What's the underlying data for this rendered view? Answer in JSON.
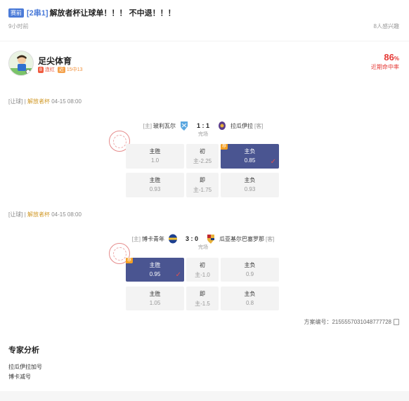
{
  "header": {
    "tag": "赛前",
    "bracket": "[2串1]",
    "title": "解放者杯让球单！！！ 不中退！！！",
    "time": "9小时前",
    "interest": "8人感兴趣"
  },
  "author": {
    "name": "足尖体育",
    "badge1_num": "8",
    "badge1_text": "连红",
    "badge2_num": "近",
    "badge2_text": "15中13",
    "hit_pct": "86",
    "hit_pct_unit": "%",
    "hit_label": "近期命中率"
  },
  "matches": [
    {
      "type": "[让球]",
      "sep": "|",
      "league": "解放者杯",
      "datetime": "04-15 08:00",
      "home_tag": "[主]",
      "home": "玻利瓦尔",
      "score": "1 : 1",
      "away": "拉瓜伊拉",
      "away_tag": "[客]",
      "status": "完场",
      "row1": {
        "home_label": "主胜",
        "home_val": "1.0",
        "mid_label": "初",
        "mid_val": "主-2.25",
        "away_label": "主负",
        "away_val": "0.85",
        "corner": "荐"
      },
      "row2": {
        "home_label": "主胜",
        "home_val": "0.93",
        "mid_label": "即",
        "mid_val": "主-1.75",
        "away_label": "主负",
        "away_val": "0.93"
      }
    },
    {
      "type": "[让球]",
      "sep": "|",
      "league": "解放者杯",
      "datetime": "04-15 08:00",
      "home_tag": "[主]",
      "home": "博卡青年",
      "score": "3 : 0",
      "away": "瓜亚基尔巴塞罗那",
      "away_tag": "[客]",
      "status": "完场",
      "row1": {
        "home_label": "主胜",
        "home_val": "0.95",
        "mid_label": "初",
        "mid_val": "主-1.0",
        "away_label": "主负",
        "away_val": "0.9",
        "corner": "荐"
      },
      "row2": {
        "home_label": "主胜",
        "home_val": "1.05",
        "mid_label": "即",
        "mid_val": "主-1.5",
        "away_label": "主负",
        "away_val": "0.8"
      }
    }
  ],
  "plan": {
    "label": "方案编号：",
    "number": "2155557031048777728"
  },
  "analysis": {
    "title": "专家分析",
    "lines": [
      "拉瓜伊拉加号",
      "博卡减号"
    ]
  },
  "colors": {
    "accent": "#4b7bd8",
    "selected": "#4a5591",
    "hit": "#e53935",
    "league": "#d19a2a"
  }
}
